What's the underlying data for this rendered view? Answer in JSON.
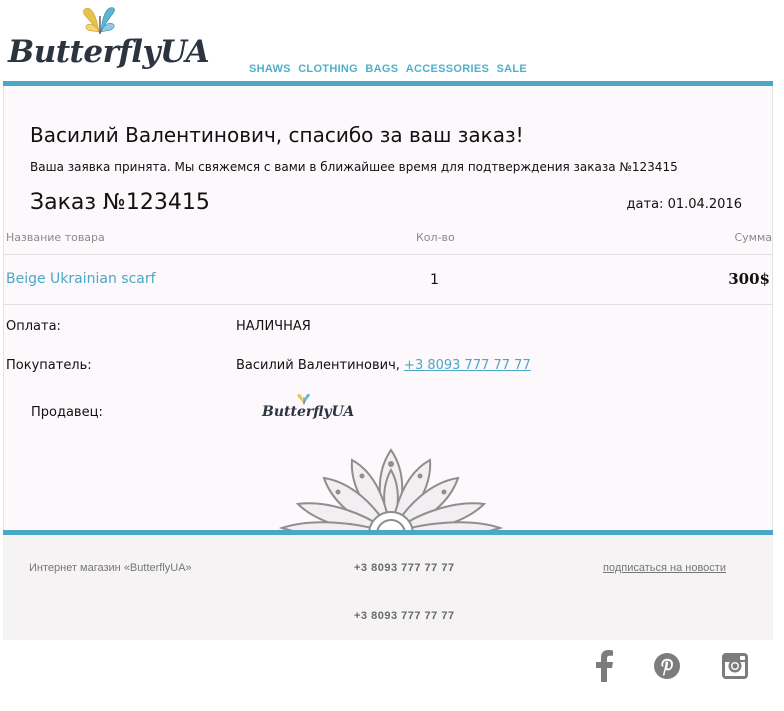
{
  "brand": {
    "logo_text": "ButterflyUA"
  },
  "topnav": {
    "items": [
      "SHAWS",
      "CLOTHING",
      "BAGS",
      "ACCESSORIES",
      "SALE"
    ]
  },
  "order": {
    "headline": "Василий Валентинович, спасибо за ваш заказ!",
    "subline": "Ваша заявка принята. Мы свяжемся с вами в ближайшее время для подтверждения заказа №123415",
    "title": "Заказ №123415",
    "date_label": "дата:",
    "date_value": "01.04.2016"
  },
  "table": {
    "headers": {
      "name": "Название товара",
      "qty": "Кол-во",
      "sum": "Сумма"
    },
    "rows": [
      {
        "name": "Beige Ukrainian scarf",
        "qty": "1",
        "sum": "300$"
      }
    ]
  },
  "details": {
    "payment_label": "Оплата:",
    "payment_value": "НАЛИЧНАЯ",
    "buyer_label": "Покупатель:",
    "buyer_name": "Василий Валентинович, ",
    "buyer_phone": "+3 8093 777 77 77",
    "seller_label": "Продавец:",
    "seller_logo_text": "ButterflyUA"
  },
  "footer": {
    "shop_name": "Интернет магазин «ButterflyUA»",
    "phone_1": "+3 8093 777 77 77",
    "phone_2": "+3 8093 777 77 77",
    "subscribe_link": "подписаться на новости"
  },
  "social": {
    "icons": [
      "facebook-icon",
      "pinterest-icon",
      "instagram-icon"
    ]
  },
  "colors": {
    "accent": "#4aa8c7",
    "nav": "#4fb0c9",
    "card_bg": "#fcf8fb",
    "footer_bg": "#f5f3f4",
    "logo": "#2c3440",
    "butterfly_yellow": "#e8c34a",
    "butterfly_blue": "#5fb4d6"
  }
}
